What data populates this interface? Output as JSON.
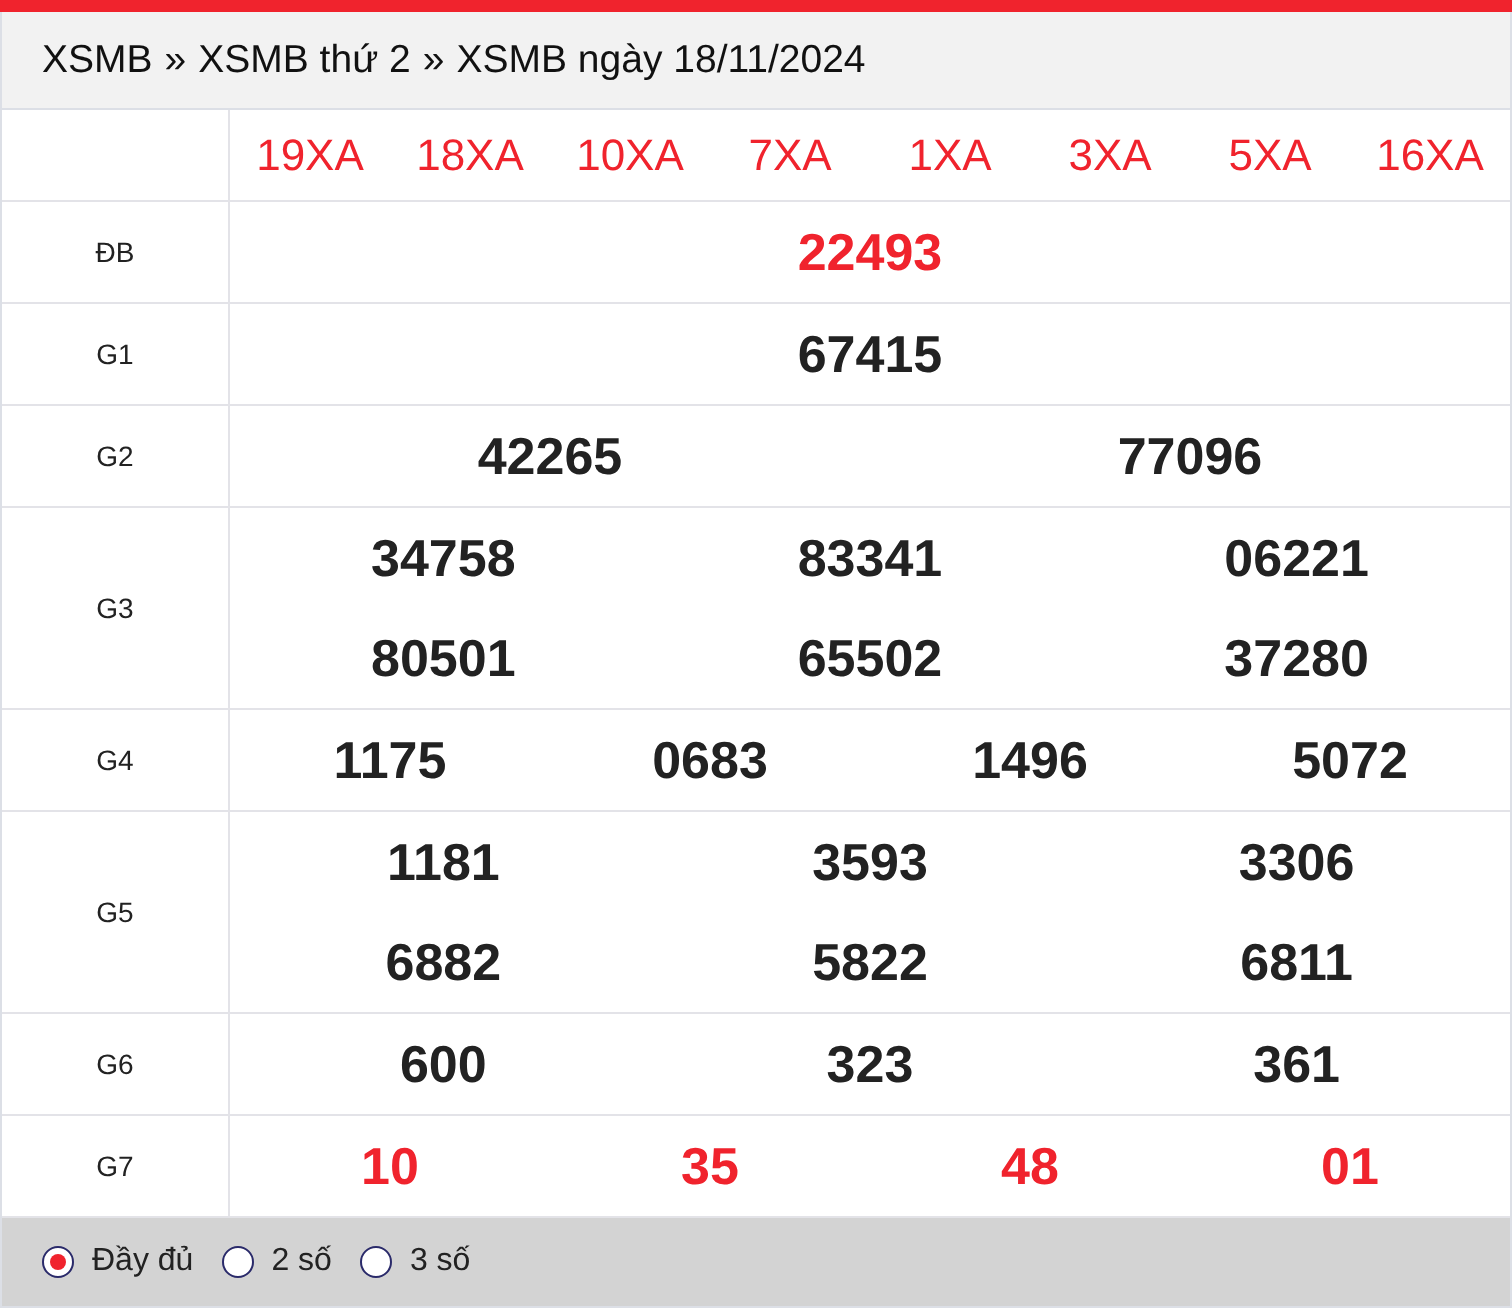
{
  "breadcrumb": [
    {
      "label": "XSMB"
    },
    {
      "label": "XSMB thứ 2"
    },
    {
      "label": "XSMB ngày 18/11/2024"
    }
  ],
  "breadcrumb_separator": "»",
  "codes": [
    "19XA",
    "18XA",
    "10XA",
    "7XA",
    "1XA",
    "3XA",
    "5XA",
    "16XA"
  ],
  "prizes": [
    {
      "label": "ĐB",
      "highlight": true,
      "numbers": [
        "22493"
      ]
    },
    {
      "label": "G1",
      "highlight": false,
      "numbers": [
        "67415"
      ]
    },
    {
      "label": "G2",
      "highlight": false,
      "numbers": [
        "42265",
        "77096"
      ]
    },
    {
      "label": "G3",
      "highlight": false,
      "numbers": [
        "34758",
        "83341",
        "06221",
        "80501",
        "65502",
        "37280"
      ]
    },
    {
      "label": "G4",
      "highlight": false,
      "numbers": [
        "1175",
        "0683",
        "1496",
        "5072"
      ]
    },
    {
      "label": "G5",
      "highlight": false,
      "numbers": [
        "1181",
        "3593",
        "3306",
        "6882",
        "5822",
        "6811"
      ]
    },
    {
      "label": "G6",
      "highlight": false,
      "numbers": [
        "600",
        "323",
        "361"
      ]
    },
    {
      "label": "G7",
      "highlight": true,
      "numbers": [
        "10",
        "35",
        "48",
        "01"
      ]
    }
  ],
  "display_options": [
    {
      "label": "Đầy đủ",
      "selected": true
    },
    {
      "label": "2 số",
      "selected": false
    },
    {
      "label": "3 số",
      "selected": false
    }
  ]
}
